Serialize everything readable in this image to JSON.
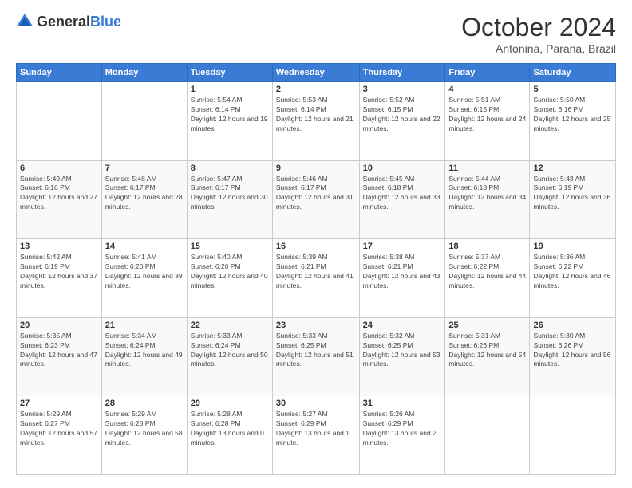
{
  "header": {
    "logo_general": "General",
    "logo_blue": "Blue",
    "month": "October 2024",
    "location": "Antonina, Parana, Brazil"
  },
  "days_of_week": [
    "Sunday",
    "Monday",
    "Tuesday",
    "Wednesday",
    "Thursday",
    "Friday",
    "Saturday"
  ],
  "weeks": [
    [
      {
        "day": "",
        "info": ""
      },
      {
        "day": "",
        "info": ""
      },
      {
        "day": "1",
        "info": "Sunrise: 5:54 AM\nSunset: 6:14 PM\nDaylight: 12 hours and 19 minutes."
      },
      {
        "day": "2",
        "info": "Sunrise: 5:53 AM\nSunset: 6:14 PM\nDaylight: 12 hours and 21 minutes."
      },
      {
        "day": "3",
        "info": "Sunrise: 5:52 AM\nSunset: 6:15 PM\nDaylight: 12 hours and 22 minutes."
      },
      {
        "day": "4",
        "info": "Sunrise: 5:51 AM\nSunset: 6:15 PM\nDaylight: 12 hours and 24 minutes."
      },
      {
        "day": "5",
        "info": "Sunrise: 5:50 AM\nSunset: 6:16 PM\nDaylight: 12 hours and 25 minutes."
      }
    ],
    [
      {
        "day": "6",
        "info": "Sunrise: 5:49 AM\nSunset: 6:16 PM\nDaylight: 12 hours and 27 minutes."
      },
      {
        "day": "7",
        "info": "Sunrise: 5:48 AM\nSunset: 6:17 PM\nDaylight: 12 hours and 28 minutes."
      },
      {
        "day": "8",
        "info": "Sunrise: 5:47 AM\nSunset: 6:17 PM\nDaylight: 12 hours and 30 minutes."
      },
      {
        "day": "9",
        "info": "Sunrise: 5:46 AM\nSunset: 6:17 PM\nDaylight: 12 hours and 31 minutes."
      },
      {
        "day": "10",
        "info": "Sunrise: 5:45 AM\nSunset: 6:18 PM\nDaylight: 12 hours and 33 minutes."
      },
      {
        "day": "11",
        "info": "Sunrise: 5:44 AM\nSunset: 6:18 PM\nDaylight: 12 hours and 34 minutes."
      },
      {
        "day": "12",
        "info": "Sunrise: 5:43 AM\nSunset: 6:19 PM\nDaylight: 12 hours and 36 minutes."
      }
    ],
    [
      {
        "day": "13",
        "info": "Sunrise: 5:42 AM\nSunset: 6:19 PM\nDaylight: 12 hours and 37 minutes."
      },
      {
        "day": "14",
        "info": "Sunrise: 5:41 AM\nSunset: 6:20 PM\nDaylight: 12 hours and 39 minutes."
      },
      {
        "day": "15",
        "info": "Sunrise: 5:40 AM\nSunset: 6:20 PM\nDaylight: 12 hours and 40 minutes."
      },
      {
        "day": "16",
        "info": "Sunrise: 5:39 AM\nSunset: 6:21 PM\nDaylight: 12 hours and 41 minutes."
      },
      {
        "day": "17",
        "info": "Sunrise: 5:38 AM\nSunset: 6:21 PM\nDaylight: 12 hours and 43 minutes."
      },
      {
        "day": "18",
        "info": "Sunrise: 5:37 AM\nSunset: 6:22 PM\nDaylight: 12 hours and 44 minutes."
      },
      {
        "day": "19",
        "info": "Sunrise: 5:36 AM\nSunset: 6:22 PM\nDaylight: 12 hours and 46 minutes."
      }
    ],
    [
      {
        "day": "20",
        "info": "Sunrise: 5:35 AM\nSunset: 6:23 PM\nDaylight: 12 hours and 47 minutes."
      },
      {
        "day": "21",
        "info": "Sunrise: 5:34 AM\nSunset: 6:24 PM\nDaylight: 12 hours and 49 minutes."
      },
      {
        "day": "22",
        "info": "Sunrise: 5:33 AM\nSunset: 6:24 PM\nDaylight: 12 hours and 50 minutes."
      },
      {
        "day": "23",
        "info": "Sunrise: 5:33 AM\nSunset: 6:25 PM\nDaylight: 12 hours and 51 minutes."
      },
      {
        "day": "24",
        "info": "Sunrise: 5:32 AM\nSunset: 6:25 PM\nDaylight: 12 hours and 53 minutes."
      },
      {
        "day": "25",
        "info": "Sunrise: 5:31 AM\nSunset: 6:26 PM\nDaylight: 12 hours and 54 minutes."
      },
      {
        "day": "26",
        "info": "Sunrise: 5:30 AM\nSunset: 6:26 PM\nDaylight: 12 hours and 56 minutes."
      }
    ],
    [
      {
        "day": "27",
        "info": "Sunrise: 5:29 AM\nSunset: 6:27 PM\nDaylight: 12 hours and 57 minutes."
      },
      {
        "day": "28",
        "info": "Sunrise: 5:29 AM\nSunset: 6:28 PM\nDaylight: 12 hours and 58 minutes."
      },
      {
        "day": "29",
        "info": "Sunrise: 5:28 AM\nSunset: 6:28 PM\nDaylight: 13 hours and 0 minutes."
      },
      {
        "day": "30",
        "info": "Sunrise: 5:27 AM\nSunset: 6:29 PM\nDaylight: 13 hours and 1 minute."
      },
      {
        "day": "31",
        "info": "Sunrise: 5:26 AM\nSunset: 6:29 PM\nDaylight: 13 hours and 2 minutes."
      },
      {
        "day": "",
        "info": ""
      },
      {
        "day": "",
        "info": ""
      }
    ]
  ]
}
